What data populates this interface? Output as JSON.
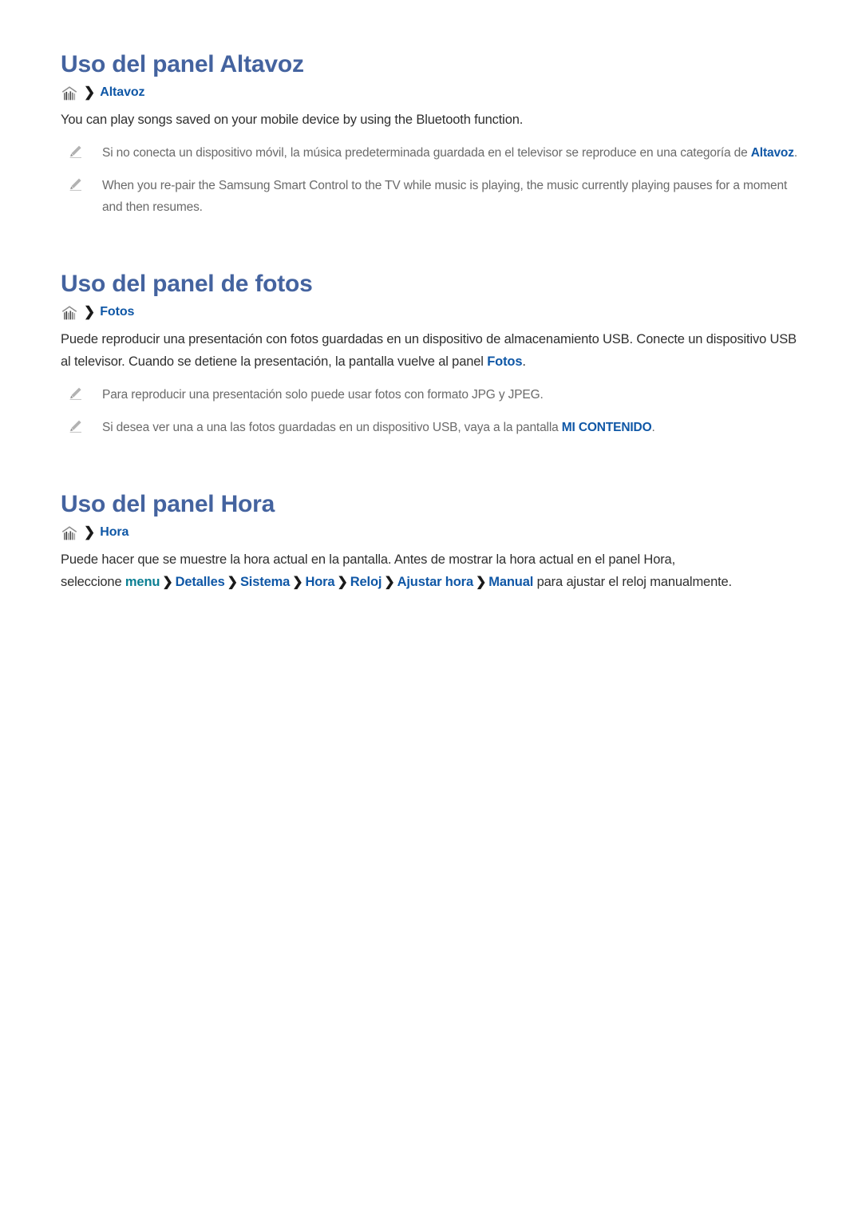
{
  "page": {
    "colors": {
      "heading": "#44639f",
      "link_blue": "#0f57a6",
      "keyword_teal": "#0b7f93",
      "body_text": "#2f2f2f",
      "note_text": "#6a6a6a",
      "background": "#ffffff"
    }
  },
  "sections": [
    {
      "title": "Uso del panel Altavoz",
      "breadcrumb": {
        "icon": "smart-hub-icon",
        "separator": "❯",
        "label": "Altavoz"
      },
      "paragraph": "You can play songs saved on your mobile device by using the Bluetooth function.",
      "notes": [
        {
          "icon": "pencil-icon",
          "text_before": "Si no conecta un dispositivo móvil, la música predeterminada guardada en el televisor se reproduce en una categoría de ",
          "keyword": "Altavoz",
          "text_after": "."
        },
        {
          "icon": "pencil-icon",
          "text_before": "When you re-pair the Samsung Smart Control to the TV while music is playing, the music currently playing pauses for a moment and then resumes.",
          "keyword": "",
          "text_after": ""
        }
      ]
    },
    {
      "title": "Uso del panel de fotos",
      "breadcrumb": {
        "icon": "smart-hub-icon",
        "separator": "❯",
        "label": "Fotos"
      },
      "paragraph_before": "Puede reproducir una presentación con fotos guardadas en un dispositivo de almacenamiento USB. Conecte un dispositivo USB al televisor. Cuando se detiene la presentación, la pantalla vuelve al panel ",
      "paragraph_keyword": "Fotos",
      "paragraph_after": ".",
      "notes": [
        {
          "icon": "pencil-icon",
          "text_before": "Para reproducir una presentación solo puede usar fotos con formato JPG y JPEG.",
          "keyword": "",
          "text_after": ""
        },
        {
          "icon": "pencil-icon",
          "text_before": "Si desea ver una a una las fotos guardadas en un dispositivo USB, vaya a la pantalla ",
          "keyword": "MI CONTENIDO",
          "text_after": "."
        }
      ]
    },
    {
      "title": "Uso del panel Hora",
      "breadcrumb": {
        "icon": "smart-hub-icon",
        "separator": "❯",
        "label": "Hora"
      },
      "paragraph_line1": "Puede hacer que se muestre la hora actual en la pantalla. Antes de mostrar la hora actual en el panel Hora,",
      "paragraph_line2_prefix": "seleccione ",
      "path": [
        {
          "label": "menu",
          "style": "teal"
        },
        {
          "label": "Detalles",
          "style": "blue"
        },
        {
          "label": "Sistema",
          "style": "blue"
        },
        {
          "label": "Hora",
          "style": "blue"
        },
        {
          "label": "Reloj",
          "style": "blue"
        },
        {
          "label": "Ajustar hora",
          "style": "blue"
        },
        {
          "label": "Manual",
          "style": "blue"
        }
      ],
      "path_separator": "❯",
      "paragraph_line2_suffix": " para ajustar el reloj manualmente."
    }
  ]
}
